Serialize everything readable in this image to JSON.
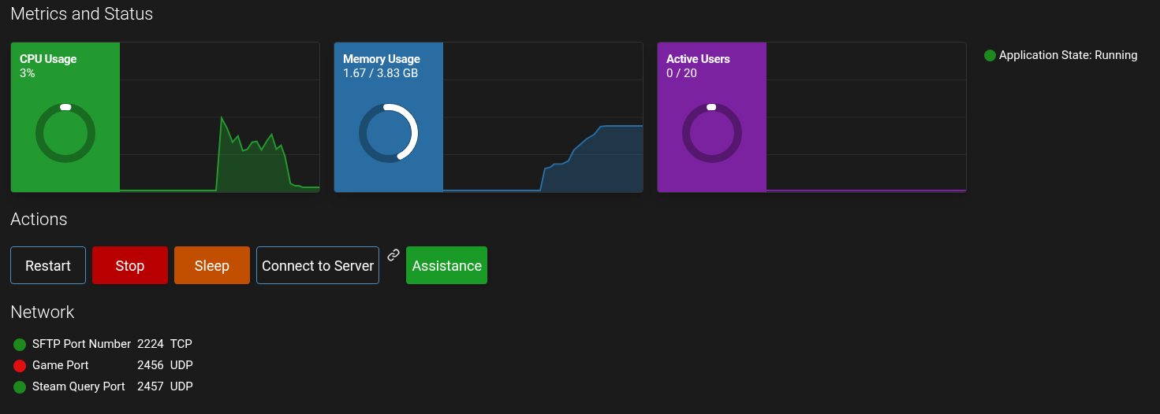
{
  "sections": {
    "metrics_title": "Metrics and Status",
    "actions_title": "Actions",
    "network_title": "Network"
  },
  "metrics": [
    {
      "kind": "cpu",
      "title": "CPU Usage",
      "value": "3%",
      "color": "#239a2f",
      "level": 0.03
    },
    {
      "kind": "memory",
      "title": "Memory Usage",
      "value": "1.67 / 3.83 GB",
      "color": "#2a6da3",
      "level": 0.44
    },
    {
      "kind": "users",
      "title": "Active Users",
      "value": "0 / 20",
      "color": "#7b22a0",
      "level": 0.0
    }
  ],
  "app_state": {
    "label": "Application State: Running",
    "color": "#1e8a1e"
  },
  "actions": [
    {
      "label": "Restart",
      "kind": "outline",
      "link_icon": false
    },
    {
      "label": "Stop",
      "kind": "filled",
      "color": "#b80000",
      "link_icon": false
    },
    {
      "label": "Sleep",
      "kind": "filled",
      "color": "#c24f00",
      "link_icon": false
    },
    {
      "label": "Connect to Server",
      "kind": "outline",
      "link_icon": true
    },
    {
      "label": "Assistance",
      "kind": "filled",
      "color": "#1a9a26",
      "link_icon": false
    }
  ],
  "network": [
    {
      "name": "SFTP Port Number",
      "port": "2224",
      "protocol": "TCP",
      "color": "#1e8a1e"
    },
    {
      "name": "Game Port",
      "port": "2456",
      "protocol": "UDP",
      "color": "#e01010"
    },
    {
      "name": "Steam Query Port",
      "port": "2457",
      "protocol": "UDP",
      "color": "#1e8a1e"
    }
  ]
}
